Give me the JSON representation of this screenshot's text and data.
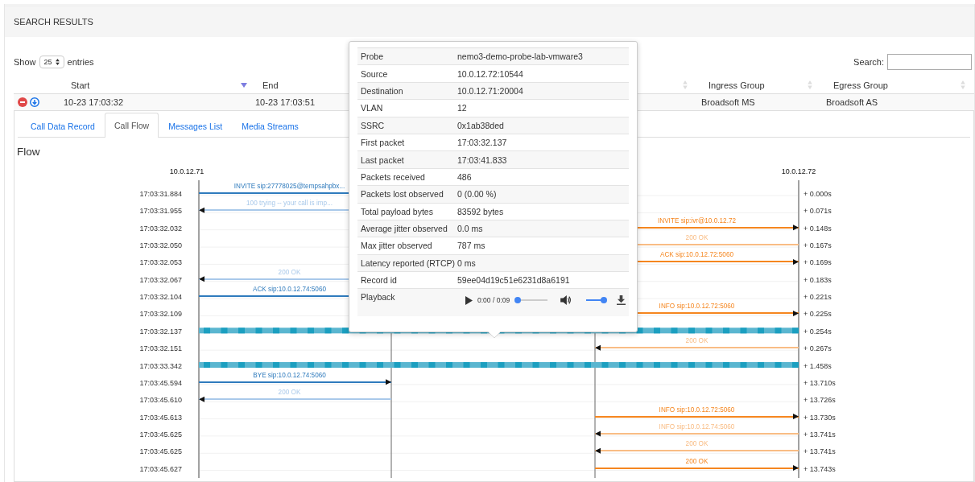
{
  "panel": {
    "title": "SEARCH RESULTS"
  },
  "length_menu": {
    "before": "Show",
    "value": "25",
    "after": "entries"
  },
  "search": {
    "label": "Search:"
  },
  "table": {
    "columns": [
      {
        "label": "Start",
        "sorted": true
      },
      {
        "label": "End",
        "sorted": false
      },
      {
        "label": "Ingress Group",
        "sorted": false
      },
      {
        "label": "Egress Group",
        "sorted": false
      }
    ],
    "rows": [
      {
        "cells": [
          "10-23 17:03:32",
          "10-23 17:03:51",
          "Broadsoft MS",
          "Broadsoft AS"
        ]
      }
    ]
  },
  "tabs": [
    {
      "label": "Call Data Record",
      "selected": false
    },
    {
      "label": "Call Flow",
      "selected": true
    },
    {
      "label": "Messages List",
      "selected": false
    },
    {
      "label": "Media Streams",
      "selected": false
    }
  ],
  "flow": {
    "title": "Flow",
    "left_host": "10.0.12.71",
    "right_host": "10.0.12.72",
    "rows": [
      {
        "time": "17:03:31.884",
        "offset": "+ 0.000s",
        "kind": "left-out",
        "label": "INVITE sip:27778025@tempsahpbx...",
        "color": "#2f7bbd"
      },
      {
        "time": "17:03:31.955",
        "offset": "+ 0.071s",
        "kind": "left-back",
        "label": "100 trying -- your call is imp...",
        "color": "#a9c9ea"
      },
      {
        "time": "17:03:32.032",
        "offset": "+ 0.148s",
        "kind": "right-out",
        "label": "INVITE sip:ivr@10.0.12.72",
        "color": "#f5861f"
      },
      {
        "time": "17:03:32.050",
        "offset": "+ 0.167s",
        "kind": "right-back",
        "label": "200 OK",
        "color": "#f9bd85"
      },
      {
        "time": "17:03:32.053",
        "offset": "+ 0.169s",
        "kind": "right-out",
        "label": "ACK sip:10.0.12.72:5060",
        "color": "#f5861f"
      },
      {
        "time": "17:03:32.067",
        "offset": "+ 0.183s",
        "kind": "left-back",
        "label": "200 OK",
        "color": "#a9c9ea"
      },
      {
        "time": "17:03:32.104",
        "offset": "+ 0.221s",
        "kind": "left-out",
        "label": "ACK sip:10.0.12.74:5060",
        "color": "#2f7bbd"
      },
      {
        "time": "17:03:32.109",
        "offset": "+ 0.225s",
        "kind": "right-out",
        "label": "INFO sip:10.0.12.72:5060",
        "color": "#f5861f"
      },
      {
        "time": "17:03:32.137",
        "offset": "+ 0.254s",
        "kind": "media"
      },
      {
        "time": "17:03:32.151",
        "offset": "+ 0.267s",
        "kind": "right-back",
        "label": "200 OK",
        "color": "#f9bd85"
      },
      {
        "time": "17:03:33.342",
        "offset": "+ 1.458s",
        "kind": "media"
      },
      {
        "time": "17:03:45.594",
        "offset": "+ 13.710s",
        "kind": "left-out",
        "label": "BYE sip:10.0.12.74:5060",
        "color": "#2f7bbd"
      },
      {
        "time": "17:03:45.610",
        "offset": "+ 13.726s",
        "kind": "left-back",
        "label": "200 OK",
        "color": "#a9c9ea"
      },
      {
        "time": "17:03:45.613",
        "offset": "+ 13.730s",
        "kind": "right-out",
        "label": "INFO sip:10.0.12.72:5060",
        "color": "#f5861f"
      },
      {
        "time": "17:03:45.625",
        "offset": "+ 13.741s",
        "kind": "right-back",
        "label": "INFO sip:10.0.12.74:5060",
        "color": "#f9bd85"
      },
      {
        "time": "17:03:45.625",
        "offset": "+ 13.741s",
        "kind": "right-back",
        "label": "200 OK",
        "color": "#f9bd85"
      },
      {
        "time": "17:03:45.627",
        "offset": "+ 13.743s",
        "kind": "right-out",
        "label": "200 OK",
        "color": "#f5861f"
      }
    ]
  },
  "popover": {
    "rows": [
      {
        "label": "Probe",
        "value": "nemo3-demo-probe-lab-vmware3"
      },
      {
        "label": "Source",
        "value": "10.0.12.72:10544"
      },
      {
        "label": "Destination",
        "value": "10.0.12.71:20004"
      },
      {
        "label": "VLAN",
        "value": "12"
      },
      {
        "label": "SSRC",
        "value": "0x1ab38ded"
      },
      {
        "label": "First packet",
        "value": "17:03:32.137"
      },
      {
        "label": "Last packet",
        "value": "17:03:41.833"
      },
      {
        "label": "Packets received",
        "value": "486"
      },
      {
        "label": "Packets lost observed",
        "value": "0 (0.00 %)"
      },
      {
        "label": "Total payload bytes",
        "value": "83592 bytes"
      },
      {
        "label": "Average jitter observed",
        "value": "0.0 ms"
      },
      {
        "label": "Max jitter observed",
        "value": "787 ms"
      },
      {
        "label": "Latency reported (RTCP)",
        "value": "0 ms"
      },
      {
        "label": "Record id",
        "value": "59ee04d19c51e6231d8a6191"
      }
    ],
    "playback": {
      "label": "Playback",
      "time": "0:00 / 0:09",
      "progress": {
        "level": 0
      },
      "volume": {
        "level": 1
      }
    }
  }
}
